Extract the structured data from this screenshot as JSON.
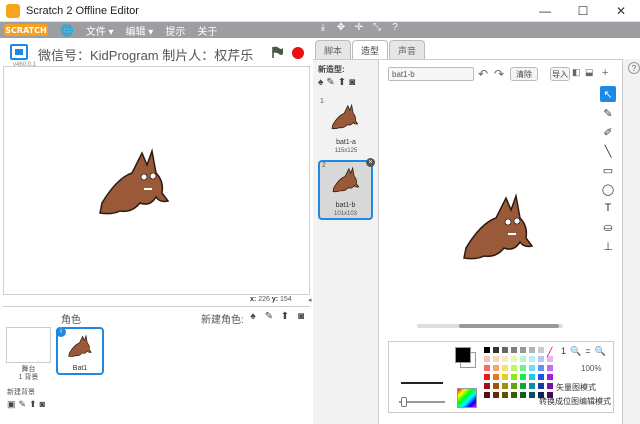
{
  "window": {
    "title": "Scratch 2 Offline Editor",
    "minimize": "—",
    "maximize": "☐",
    "close": "✕"
  },
  "menubar": {
    "logo": "SCRATCH",
    "items": [
      "文件 ▾",
      "编辑 ▾",
      "提示",
      "关于"
    ],
    "tools": [
      "⤓",
      "✥",
      "✛",
      "⤡",
      "?"
    ]
  },
  "stage": {
    "title": "微信号：KidProgram  制片人：权芹乐",
    "version": "v460.0.1",
    "coords": {
      "x_label": "x:",
      "x": "226",
      "y_label": "y:",
      "y": "154"
    }
  },
  "sprites": {
    "header": "角色",
    "new_label": "新建角色:",
    "stage_label": "舞台",
    "stage_sub": "1 背景",
    "new_bg_label": "新建背景",
    "items": [
      {
        "name": "Bat1",
        "info": "i"
      }
    ]
  },
  "tabs": [
    "脚本",
    "造型",
    "声音"
  ],
  "costumes": {
    "new_label": "新造型:",
    "items": [
      {
        "num": "1",
        "name": "bat1-a",
        "size": "115x125"
      },
      {
        "num": "2",
        "name": "bat1-b",
        "size": "101x103"
      }
    ]
  },
  "editor": {
    "name_value": "bat1-b",
    "clear_label": "清除",
    "import_label": "导入",
    "zoom_value": "100%",
    "mode_label": "矢量图模式",
    "convert_label": "转换成位图编辑模式",
    "tools": [
      "↖",
      "✎",
      "✐",
      "╲",
      "▭",
      "◯",
      "T",
      "⛀",
      "⊥"
    ]
  },
  "colors": {
    "accent": "#1e88e5",
    "menubar": "#9c9ea2",
    "palette": [
      "#000000",
      "#333333",
      "#666666",
      "#808080",
      "#999999",
      "#b3b3b3",
      "#cccccc",
      "#ffffff",
      "#f9c3b5",
      "#f9d7b5",
      "#f9ecb5",
      "#e9f9b5",
      "#b5f9c7",
      "#b5f0f9",
      "#b5c7f9",
      "#e5b5f9",
      "#f46a6a",
      "#f4a96a",
      "#f4e06a",
      "#bcf46a",
      "#6af48f",
      "#6adef4",
      "#6a8ff4",
      "#c66af4",
      "#e81b1b",
      "#e8761b",
      "#e8cd1b",
      "#8de81b",
      "#1be855",
      "#1bc8e8",
      "#1b55e8",
      "#a41be8",
      "#a31212",
      "#a35212",
      "#a38f12",
      "#62a312",
      "#12a33b",
      "#128ca3",
      "#123ba3",
      "#7312a3",
      "#5c0a0a",
      "#5c2e0a",
      "#5c510a",
      "#375c0a",
      "#0a5c21",
      "#0a4f5c",
      "#0a215c",
      "#410a5c"
    ]
  }
}
